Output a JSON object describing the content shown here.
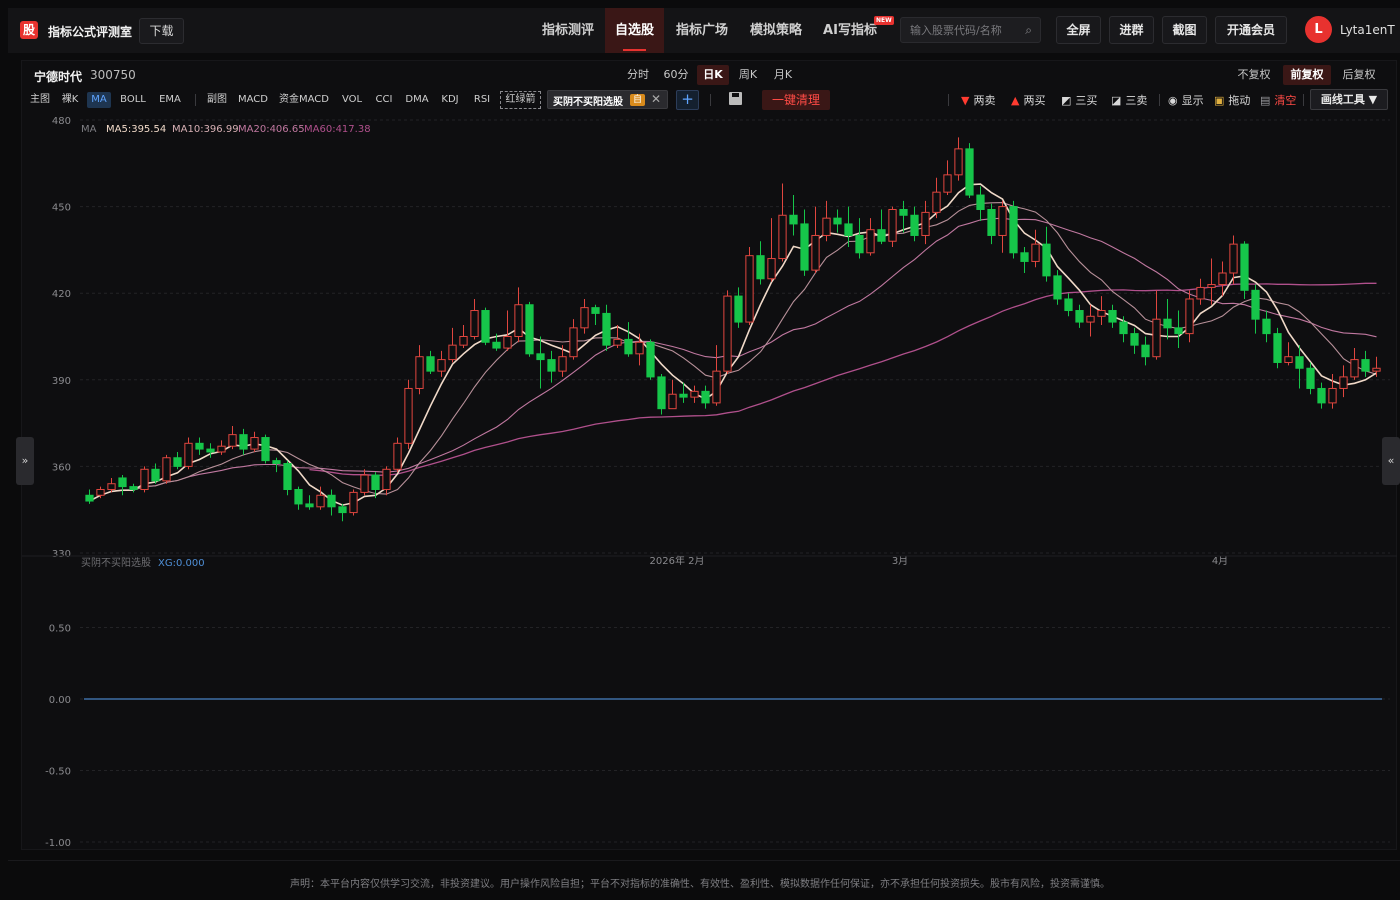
{
  "header": {
    "logo_char": "股",
    "app_title": "指标公式评测室",
    "download": "下载",
    "nav": [
      {
        "label": "指标测评",
        "active": false
      },
      {
        "label": "自选股",
        "active": true
      },
      {
        "label": "指标广场",
        "active": false
      },
      {
        "label": "模拟策略",
        "active": false
      },
      {
        "label": "AI写指标",
        "active": false
      }
    ],
    "new_badge": "NEW",
    "search_placeholder": "输入股票代码/名称",
    "buttons": [
      "全屏",
      "进群",
      "截图",
      "开通会员"
    ],
    "avatar_letter": "L",
    "username": "Lyta1enT"
  },
  "stock": {
    "name": "宁德时代",
    "code": "300750"
  },
  "periods": [
    {
      "label": "分时",
      "active": false
    },
    {
      "label": "60分",
      "active": false
    },
    {
      "label": "日K",
      "active": true
    },
    {
      "label": "周K",
      "active": false
    },
    {
      "label": "月K",
      "active": false
    }
  ],
  "adjustments": [
    {
      "label": "不复权",
      "active": false
    },
    {
      "label": "前复权",
      "active": true
    },
    {
      "label": "后复权",
      "active": false
    }
  ],
  "indicators_main": [
    {
      "label": "主图",
      "active": false
    },
    {
      "label": "裸K",
      "active": false
    },
    {
      "label": "MA",
      "active": true
    },
    {
      "label": "BOLL",
      "active": false
    },
    {
      "label": "EMA",
      "active": false
    }
  ],
  "indicators_sub": [
    "副图",
    "MACD",
    "资金MACD",
    "VOL",
    "CCI",
    "DMA",
    "KDJ",
    "RSI"
  ],
  "hongluo": "红绿箭",
  "formula_chip": {
    "label": "买阴不买阳选股",
    "tag": "自"
  },
  "clear_all": "一键清理",
  "signals": [
    {
      "label": "两卖",
      "marker": "▼",
      "color": "#ff3b30"
    },
    {
      "label": "两买",
      "marker": "▲",
      "color": "#ff3b30"
    },
    {
      "label": "三买",
      "marker": "◩",
      "color": "#d0d0d0"
    },
    {
      "label": "三卖",
      "marker": "◪",
      "color": "#d0d0d0"
    },
    {
      "label": "显示",
      "marker": "◉",
      "color": "#d0d0d0"
    },
    {
      "label": "拖动",
      "marker": "🔒",
      "color": "#e0b040"
    },
    {
      "label": "清空",
      "marker": "🗑",
      "color": "#ff4b46"
    }
  ],
  "draw_tools": "画线工具 ▼",
  "ma_legend": [
    {
      "label": "MA",
      "color": "#7d7d82"
    },
    {
      "label": "MA5:395.54",
      "color": "#f0d9c8"
    },
    {
      "label": "MA10:396.99",
      "color": "#d7b0b4"
    },
    {
      "label": "MA20:406.65",
      "color": "#c078a0"
    },
    {
      "label": "MA60:417.38",
      "color": "#b0508c"
    }
  ],
  "sub_legend": {
    "label": "买阴不买阳选股",
    "value": "XG:0.000"
  },
  "time_labels": [
    "2026年 2月",
    "3月",
    "4月"
  ],
  "disclaimer": "声明：本平台内容仅供学习交流，非投资建议。用户操作风险自担；平台不对指标的准确性、有效性、盈利性、模拟数据作任何保证，亦不承担任何投资损失。股市有风险，投资需谨慎。",
  "chart_data": {
    "type": "candlestick",
    "ylim_main": [
      330,
      480
    ],
    "yticks_main": [
      "480",
      "450",
      "420",
      "390",
      "360",
      "330"
    ],
    "ylim_sub": [
      -1.0,
      1.0
    ],
    "yticks_sub": [
      "0.50",
      "0.00",
      "-0.50",
      "-1.00"
    ],
    "candles": [
      [
        350,
        348,
        352,
        347
      ],
      [
        350,
        352,
        353,
        349
      ],
      [
        352,
        354,
        356,
        351
      ],
      [
        356,
        353,
        357,
        350
      ],
      [
        353,
        352,
        354,
        351
      ],
      [
        352,
        359,
        360,
        351
      ],
      [
        359,
        355,
        361,
        354
      ],
      [
        355,
        363,
        364,
        354
      ],
      [
        363,
        360,
        365,
        359
      ],
      [
        360,
        368,
        370,
        359
      ],
      [
        368,
        366,
        370,
        364
      ],
      [
        366,
        365,
        368,
        363
      ],
      [
        365,
        367,
        369,
        364
      ],
      [
        367,
        371,
        374,
        366
      ],
      [
        371,
        366,
        373,
        364
      ],
      [
        366,
        370,
        372,
        365
      ],
      [
        370,
        362,
        371,
        361
      ],
      [
        362,
        361,
        363,
        358
      ],
      [
        361,
        352,
        362,
        350
      ],
      [
        352,
        347,
        353,
        345
      ],
      [
        347,
        346,
        350,
        345
      ],
      [
        346,
        350,
        353,
        345
      ],
      [
        350,
        346,
        352,
        343
      ],
      [
        346,
        344,
        347,
        341
      ],
      [
        344,
        351,
        352,
        343
      ],
      [
        351,
        357,
        359,
        350
      ],
      [
        357,
        352,
        358,
        349
      ],
      [
        352,
        359,
        360,
        350
      ],
      [
        359,
        368,
        370,
        358
      ],
      [
        368,
        387,
        390,
        366
      ],
      [
        387,
        398,
        402,
        385
      ],
      [
        398,
        393,
        400,
        392
      ],
      [
        393,
        397,
        400,
        391
      ],
      [
        397,
        402,
        408,
        396
      ],
      [
        402,
        405,
        409,
        401
      ],
      [
        405,
        414,
        418,
        404
      ],
      [
        414,
        403,
        415,
        402
      ],
      [
        403,
        401,
        406,
        400
      ],
      [
        401,
        405,
        414,
        400
      ],
      [
        405,
        416,
        422,
        403
      ],
      [
        416,
        399,
        417,
        398
      ],
      [
        399,
        397,
        405,
        387
      ],
      [
        397,
        393,
        400,
        389
      ],
      [
        393,
        398,
        402,
        391
      ],
      [
        398,
        408,
        411,
        397
      ],
      [
        408,
        415,
        418,
        406
      ],
      [
        415,
        413,
        416,
        409
      ],
      [
        413,
        402,
        416,
        400
      ],
      [
        402,
        404,
        409,
        401
      ],
      [
        404,
        399,
        410,
        398
      ],
      [
        399,
        403,
        406,
        395
      ],
      [
        403,
        391,
        404,
        390
      ],
      [
        391,
        380,
        392,
        378
      ],
      [
        380,
        385,
        390,
        384
      ],
      [
        385,
        384,
        389,
        382
      ],
      [
        384,
        386,
        388,
        382
      ],
      [
        386,
        382,
        388,
        380
      ],
      [
        382,
        393,
        402,
        381
      ],
      [
        393,
        419,
        421,
        392
      ],
      [
        419,
        410,
        422,
        408
      ],
      [
        410,
        433,
        436,
        409
      ],
      [
        433,
        425,
        438,
        423
      ],
      [
        425,
        432,
        446,
        424
      ],
      [
        432,
        447,
        458,
        431
      ],
      [
        447,
        444,
        454,
        440
      ],
      [
        444,
        428,
        449,
        426
      ],
      [
        428,
        440,
        450,
        427
      ],
      [
        440,
        446,
        452,
        438
      ],
      [
        446,
        444,
        449,
        441
      ],
      [
        444,
        440,
        450,
        436
      ],
      [
        440,
        434,
        446,
        432
      ],
      [
        434,
        442,
        446,
        433
      ],
      [
        442,
        438,
        449,
        437
      ],
      [
        438,
        449,
        450,
        436
      ],
      [
        449,
        447,
        452,
        441
      ],
      [
        447,
        440,
        450,
        438
      ],
      [
        440,
        448,
        452,
        437
      ],
      [
        448,
        455,
        460,
        446
      ],
      [
        455,
        461,
        466,
        454
      ],
      [
        461,
        470,
        474,
        459
      ],
      [
        470,
        454,
        472,
        453
      ],
      [
        454,
        449,
        457,
        445
      ],
      [
        449,
        440,
        451,
        437
      ],
      [
        440,
        450,
        452,
        434
      ],
      [
        450,
        434,
        452,
        432
      ],
      [
        434,
        431,
        436,
        427
      ],
      [
        431,
        437,
        442,
        429
      ],
      [
        437,
        426,
        443,
        424
      ],
      [
        426,
        418,
        428,
        416
      ],
      [
        418,
        414,
        420,
        412
      ],
      [
        414,
        410,
        416,
        408
      ],
      [
        410,
        412,
        416,
        405
      ],
      [
        412,
        414,
        419,
        409
      ],
      [
        414,
        410,
        416,
        408
      ],
      [
        410,
        406,
        412,
        403
      ],
      [
        406,
        402,
        408,
        399
      ],
      [
        402,
        398,
        405,
        395
      ],
      [
        398,
        411,
        421,
        397
      ],
      [
        411,
        408,
        418,
        404
      ],
      [
        408,
        406,
        414,
        401
      ],
      [
        406,
        418,
        421,
        403
      ],
      [
        418,
        422,
        425,
        416
      ],
      [
        422,
        423,
        432,
        416
      ],
      [
        423,
        427,
        431,
        419
      ],
      [
        427,
        437,
        440,
        423
      ],
      [
        437,
        421,
        438,
        418
      ],
      [
        421,
        411,
        423,
        406
      ],
      [
        411,
        406,
        414,
        403
      ],
      [
        406,
        396,
        408,
        394
      ],
      [
        396,
        398,
        403,
        395
      ],
      [
        398,
        394,
        402,
        387
      ],
      [
        394,
        387,
        396,
        385
      ],
      [
        387,
        382,
        389,
        380
      ],
      [
        382,
        387,
        392,
        380
      ],
      [
        387,
        391,
        395,
        384
      ],
      [
        391,
        397,
        401,
        390
      ],
      [
        397,
        393,
        400,
        391
      ],
      [
        393,
        394,
        398,
        391
      ]
    ],
    "sub_series": {
      "name": "XG",
      "value": 0.0
    }
  }
}
